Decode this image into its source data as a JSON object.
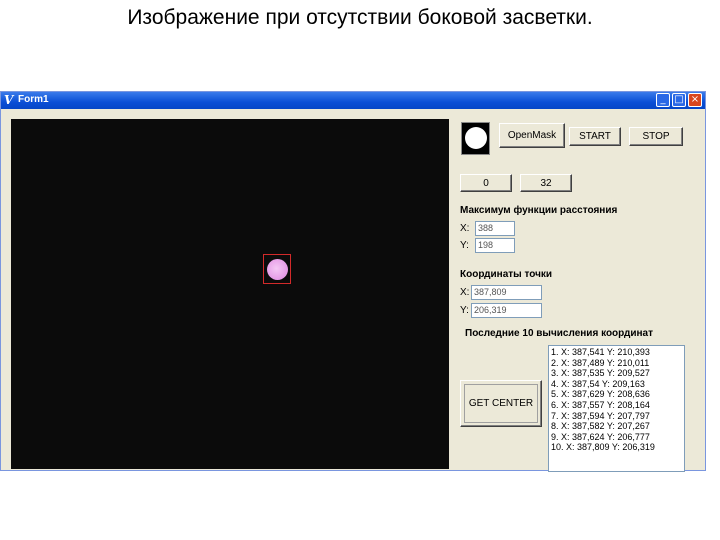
{
  "slide": {
    "title": "Изображение при отсутствии боковой засветки."
  },
  "window": {
    "icon_glyph": "V",
    "title": "Form1",
    "minimize_glyph": "_",
    "maximize_glyph": "□",
    "close_glyph": "×"
  },
  "toolbar": {
    "open_mask_label": "OpenMask",
    "start_label": "START",
    "stop_label": "STOP",
    "btn_0_label": "0",
    "btn_32_label": "32"
  },
  "distance": {
    "heading": "Максимум функции расстояния",
    "x_label": "X:",
    "x_value": "388",
    "y_label": "Y:",
    "y_value": "198"
  },
  "point": {
    "heading": "Координаты точки",
    "x_label": "X:",
    "x_value": "387,809",
    "y_label": "Y:",
    "y_value": "206,319"
  },
  "history": {
    "heading": "Последние 10 вычисления координат",
    "items": [
      "1. X: 387,541 Y: 210,393",
      "2. X: 387,489 Y: 210,011",
      "3. X: 387,535 Y: 209,527",
      "4. X: 387,54 Y: 209,163",
      "5. X: 387,629 Y: 208,636",
      "6. X: 387,557 Y: 208,164",
      "7. X: 387,594 Y: 207,797",
      "8. X: 387,582 Y: 207,267",
      "9. X: 387,624 Y: 206,777",
      "10. X: 387,809 Y: 206,319"
    ]
  },
  "get_center_label": "GET CENTER"
}
